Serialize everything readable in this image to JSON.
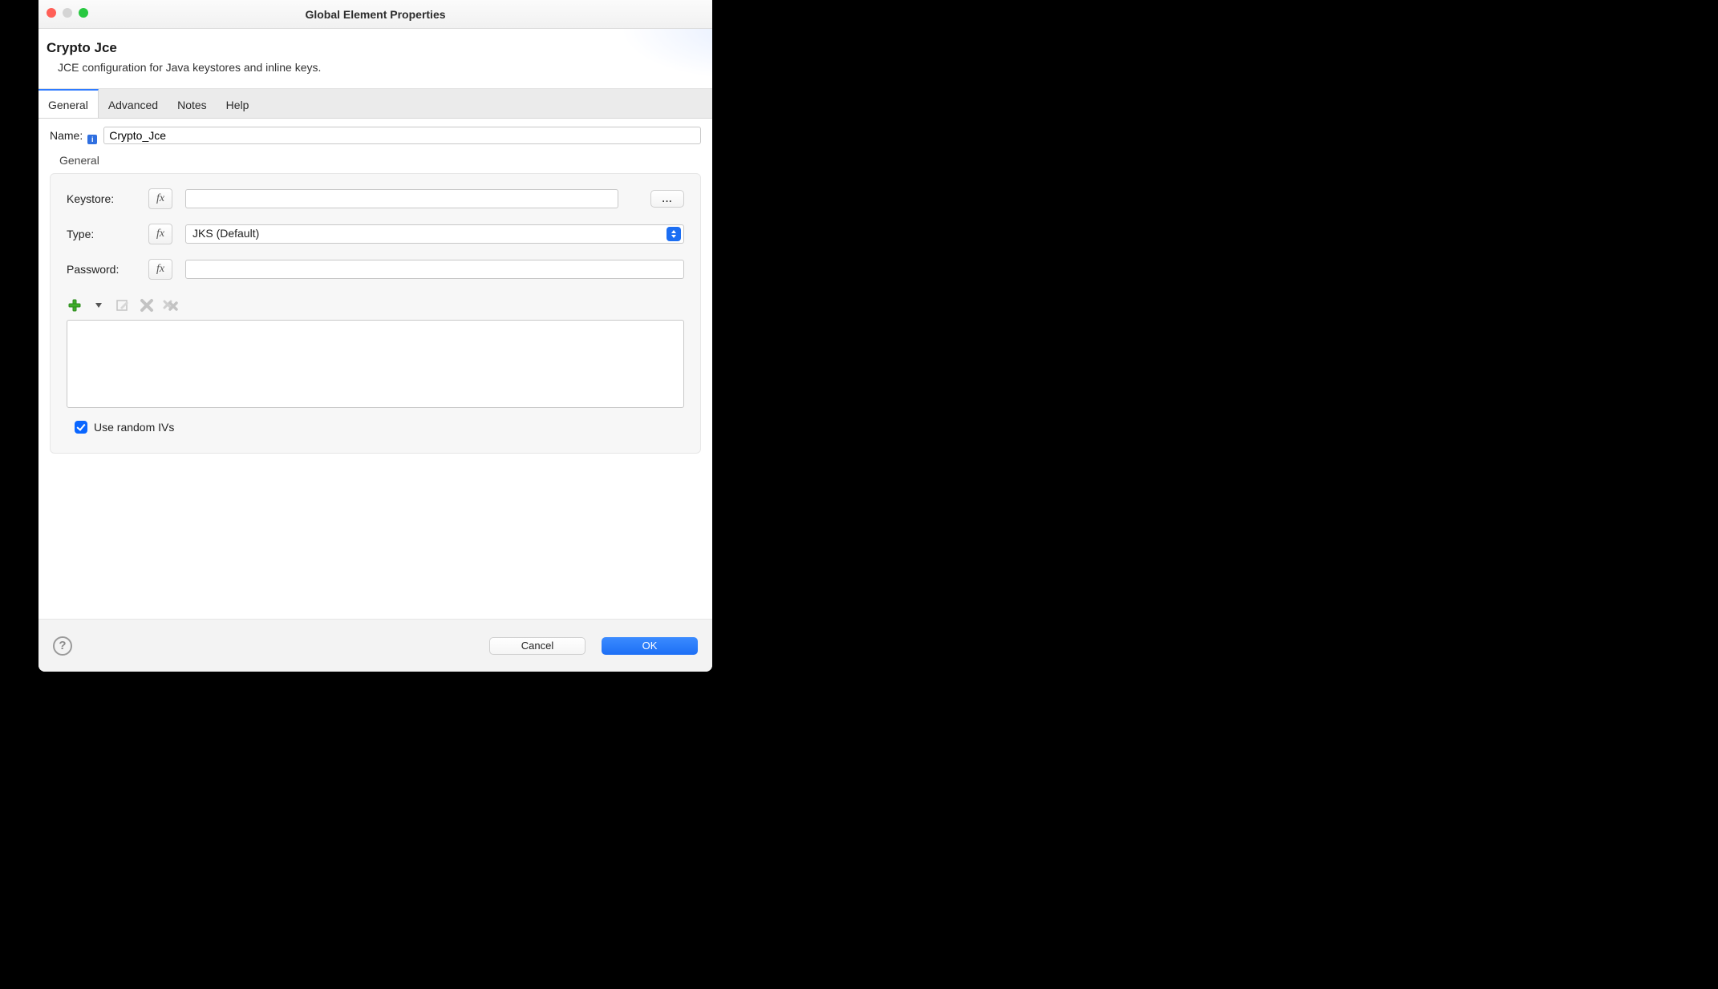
{
  "window": {
    "title": "Global Element Properties"
  },
  "header": {
    "title": "Crypto Jce",
    "subtitle": "JCE configuration for Java keystores and inline keys."
  },
  "tabs": {
    "general": "General",
    "advanced": "Advanced",
    "notes": "Notes",
    "help": "Help"
  },
  "form": {
    "name_label": "Name:",
    "name_value": "Crypto_Jce",
    "section_label": "General",
    "keystore_label": "Keystore:",
    "keystore_value": "",
    "browse_label": "...",
    "type_label": "Type:",
    "type_selected": "JKS (Default)",
    "password_label": "Password:",
    "password_value": "",
    "fx_label": "fx",
    "random_ivs_label": "Use random IVs",
    "random_ivs_checked": true
  },
  "footer": {
    "cancel": "Cancel",
    "ok": "OK"
  }
}
